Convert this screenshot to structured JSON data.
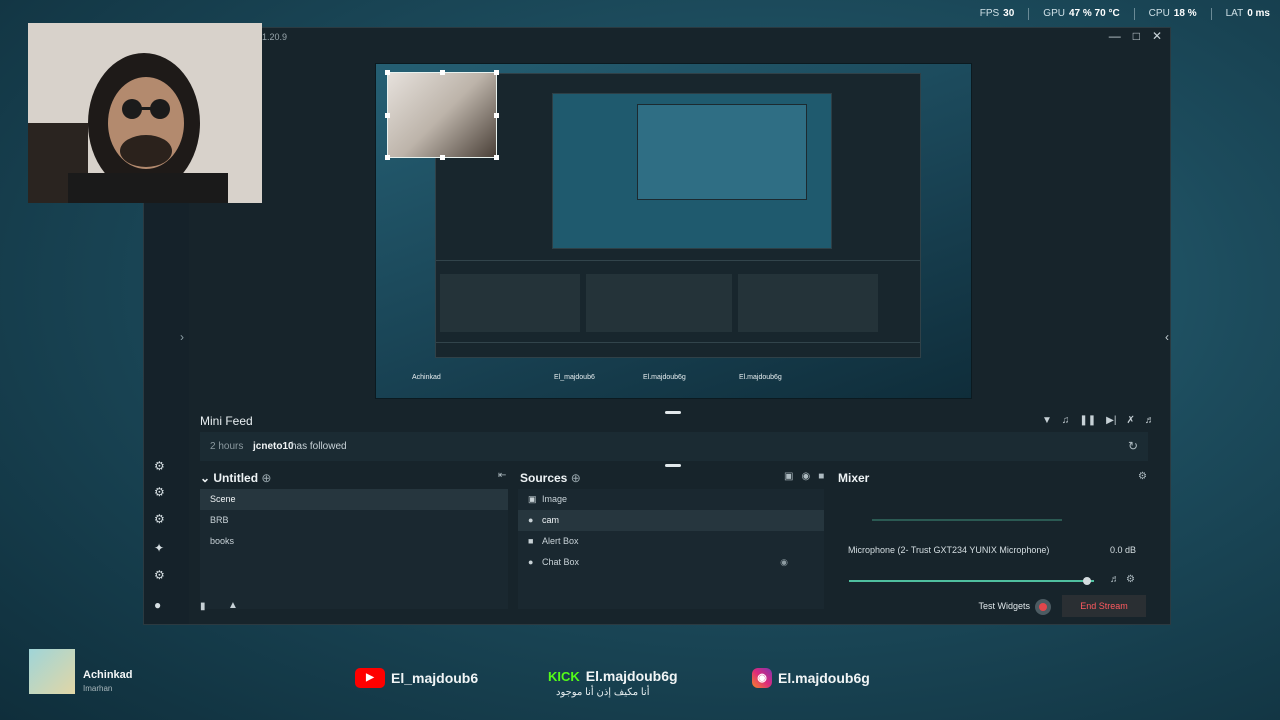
{
  "stats": {
    "fps_label": "FPS",
    "fps": "30",
    "gpu_label": "GPU",
    "gpu": "47 % 70 °C",
    "cpu_label": "CPU",
    "cpu": "18 %",
    "lat_label": "LAT",
    "lat": "0 ms"
  },
  "app": {
    "version": "1.20.9"
  },
  "minifeed": {
    "title": "Mini Feed",
    "event": {
      "time": "2 hours",
      "user": "jcneto10",
      "action": "has followed"
    }
  },
  "scenes": {
    "title": "Untitled",
    "items": [
      "Scene",
      "BRB",
      "books"
    ],
    "selected": "Scene"
  },
  "sources": {
    "title": "Sources",
    "items": [
      "Image",
      "cam",
      "Alert Box",
      "Chat Box"
    ],
    "selected": "cam"
  },
  "mixer": {
    "title": "Mixer",
    "channel": {
      "name": "Microphone (2- Trust GXT234 YUNIX Microphone)",
      "level": "0.0 dB",
      "volume_fraction": 0.97
    }
  },
  "bottombar": {
    "test_widgets": "Test Widgets",
    "end_stream": "End Stream"
  },
  "overlay": {
    "channel_name": "Achinkad",
    "channel_sub": "Imarhan",
    "youtube": "El_majdoub6",
    "kick_tag": "KICK",
    "kick": "El.majdoub6g",
    "kick_sub": "أنا مكيف إذن أنا موجود",
    "instagram": "El.majdoub6g"
  },
  "colors": {
    "accent": "#4fbf9f",
    "end_stream": "#ff5a5f",
    "kick": "#53fc18"
  }
}
